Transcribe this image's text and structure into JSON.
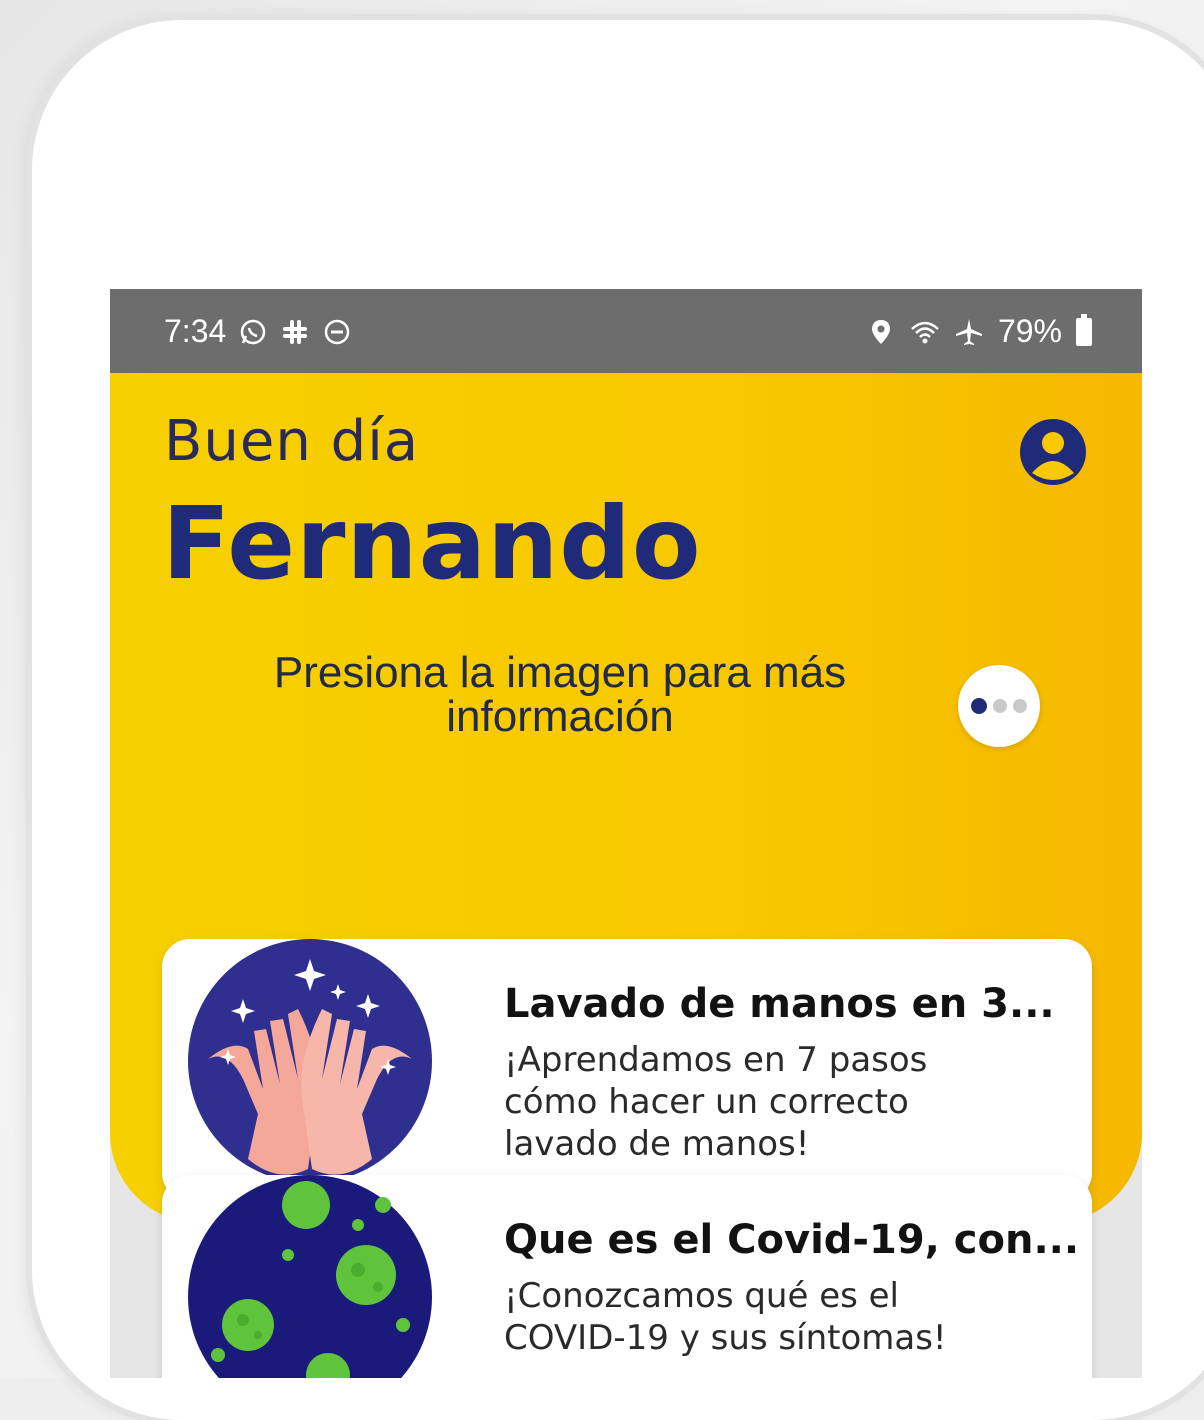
{
  "status_bar": {
    "time": "7:34",
    "battery_text": "79%",
    "icons_left": [
      "whatsapp-icon",
      "slack-icon",
      "do-not-disturb-icon"
    ],
    "icons_right": [
      "location-icon",
      "wifi-icon",
      "airplane-icon",
      "battery-icon"
    ]
  },
  "header": {
    "greeting": "Buen día",
    "name": "Fernando",
    "hint": "Presiona la imagen para más información",
    "accent_color": "#f7c800",
    "name_color": "#1f2a78"
  },
  "cards": [
    {
      "title": "Lavado de manos en 3...",
      "description": "¡Aprendamos en 7 pasos cómo hacer un correcto lavado de manos!",
      "image_icon": "clean-hands-icon"
    },
    {
      "title": "Que es el Covid-19, con...",
      "description": "¡Conozcamos qué es el COVID-19 y sus síntomas!",
      "image_icon": "virus-icon"
    }
  ]
}
